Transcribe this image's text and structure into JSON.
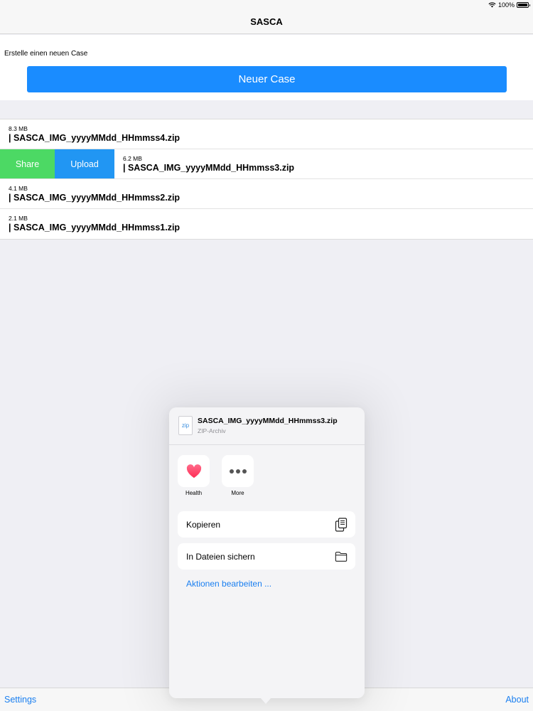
{
  "status_bar": {
    "battery_percent": "100%"
  },
  "nav": {
    "title": "SASCA"
  },
  "new_case": {
    "label": "Erstelle einen neuen Case",
    "button_label": "Neuer Case"
  },
  "files": [
    {
      "size": "8.3 MB",
      "name": "| SASCA_IMG_yyyyMMdd_HHmmss4.zip"
    },
    {
      "size": "6.2 MB",
      "name": "| SASCA_IMG_yyyyMMdd_HHmmss3.zip"
    },
    {
      "size": "4.1 MB",
      "name": "| SASCA_IMG_yyyyMMdd_HHmmss2.zip"
    },
    {
      "size": "2.1 MB",
      "name": "| SASCA_IMG_yyyyMMdd_HHmmss1.zip"
    }
  ],
  "swipe_actions": {
    "share": "Share",
    "upload": "Upload",
    "colors": {
      "share": "#4cd964",
      "upload": "#2196f3"
    }
  },
  "share_sheet": {
    "filename": "SASCA_IMG_yyyyMMdd_HHmmss3.zip",
    "filetype": "ZIP-Archiv",
    "file_icon_text": "zip",
    "apps": [
      {
        "label": "Health",
        "icon": "heart-icon"
      },
      {
        "label": "More",
        "icon": "more-dots-icon"
      }
    ],
    "actions": [
      {
        "label": "Kopieren",
        "icon": "copy-icon"
      },
      {
        "label": "In Dateien sichern",
        "icon": "folder-icon"
      }
    ],
    "edit_actions": "Aktionen bearbeiten ..."
  },
  "toolbar": {
    "settings": "Settings",
    "about": "About"
  },
  "colors": {
    "accent": "#1a7ff0",
    "button": "#1a8cff",
    "background": "#efeff4"
  }
}
